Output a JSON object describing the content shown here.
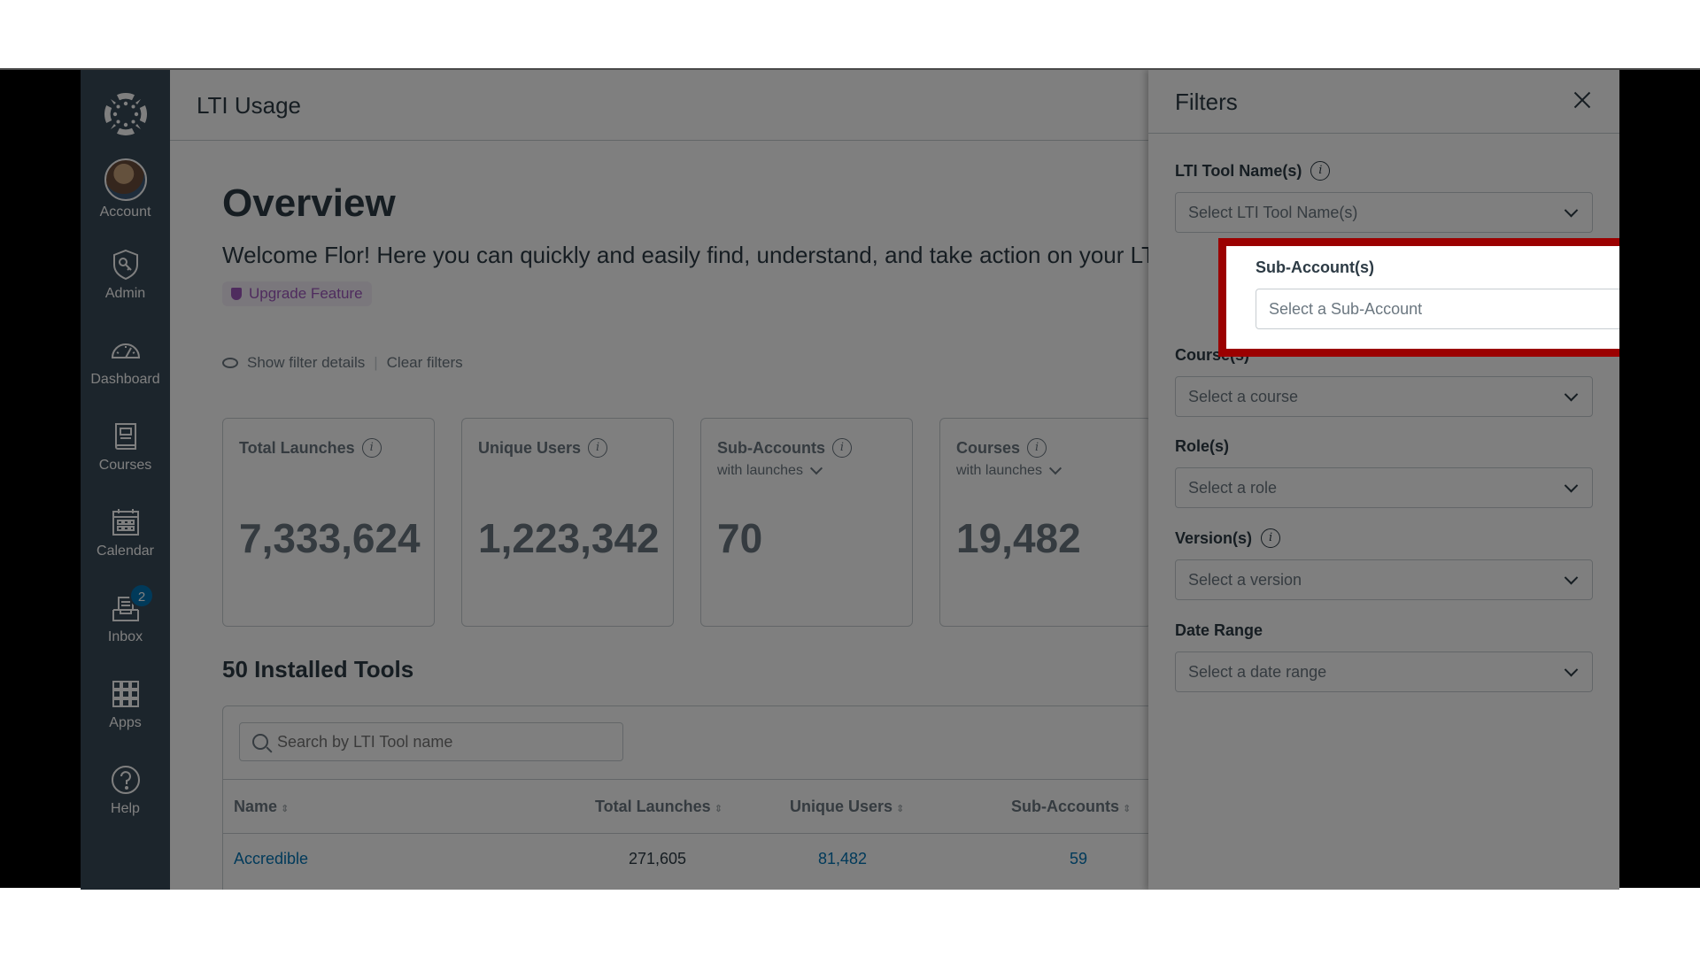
{
  "sidebar": {
    "items": [
      {
        "label": "Account",
        "icon": "avatar"
      },
      {
        "label": "Admin",
        "icon": "shield-key-icon"
      },
      {
        "label": "Dashboard",
        "icon": "speedometer-icon"
      },
      {
        "label": "Courses",
        "icon": "book-icon"
      },
      {
        "label": "Calendar",
        "icon": "calendar-icon"
      },
      {
        "label": "Inbox",
        "icon": "inbox-icon",
        "badge": "2"
      },
      {
        "label": "Apps",
        "icon": "grid-icon"
      },
      {
        "label": "Help",
        "icon": "question-circle-icon"
      }
    ]
  },
  "header": {
    "title": "LTI Usage"
  },
  "main": {
    "heading": "Overview",
    "welcome": "Welcome Flor! Here you can quickly and easily find, understand, and take action on your LTI",
    "upgrade_label": "Upgrade Feature",
    "show_filter_details": "Show filter details",
    "clear_filters": "Clear filters",
    "cards": [
      {
        "title": "Total Launches",
        "subtitle": "",
        "value": "7,333,624"
      },
      {
        "title": "Unique Users",
        "subtitle": "",
        "value": "1,223,342"
      },
      {
        "title": "Sub-Accounts",
        "subtitle": "with launches",
        "value": "70"
      },
      {
        "title": "Courses",
        "subtitle": "with launches",
        "value": "19,482"
      }
    ],
    "tools_heading": "50 Installed Tools",
    "search_placeholder": "Search by LTI Tool name",
    "table": {
      "columns": [
        "Name",
        "Total Launches",
        "Unique Users",
        "Sub-Accounts"
      ],
      "rows": [
        {
          "name": "Accredible",
          "total_launches": "271,605",
          "unique_users": "81,482",
          "sub_accounts": "59"
        }
      ]
    }
  },
  "filters": {
    "title": "Filters",
    "fields": [
      {
        "label": "LTI Tool Name(s)",
        "placeholder": "Select LTI Tool Name(s)",
        "info": true
      },
      {
        "label": "Sub-Account(s)",
        "placeholder": "Select a Sub-Account",
        "info": false,
        "highlighted": true
      },
      {
        "label": "Course(s)",
        "placeholder": "Select a course",
        "info": false
      },
      {
        "label": "Role(s)",
        "placeholder": "Select a role",
        "info": false
      },
      {
        "label": "Version(s)",
        "placeholder": "Select a version",
        "info": true
      },
      {
        "label": "Date Range",
        "placeholder": "Select a date range",
        "info": false
      }
    ]
  },
  "colors": {
    "highlight_border": "#9b0000",
    "link": "#0374b5",
    "sidebar": "#394b58",
    "upgrade": "#9e58bd"
  }
}
